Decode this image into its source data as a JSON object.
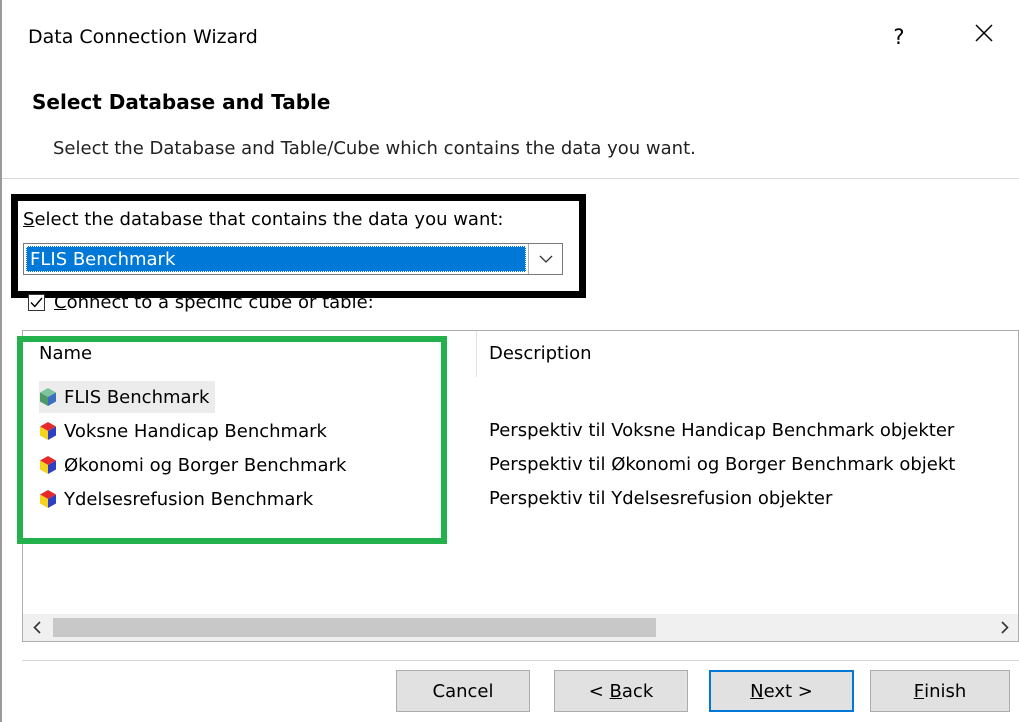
{
  "window": {
    "title": "Data Connection Wizard",
    "help_label": "?"
  },
  "page": {
    "heading": "Select Database and Table",
    "subheading": "Select the Database and Table/Cube which contains the data you want."
  },
  "database": {
    "label_mnemonic": "S",
    "label_rest": "elect the database that contains the data you want:",
    "selected": "FLIS Benchmark"
  },
  "connect_checkbox": {
    "checked": true,
    "label_mnemonic": "C",
    "label_rest": "onnect to a specific cube or table:"
  },
  "table": {
    "columns": {
      "name": "Name",
      "description": "Description"
    },
    "rows": [
      {
        "name": "FLIS Benchmark",
        "description": "",
        "icon": "cube-icon",
        "selected": true
      },
      {
        "name": "Voksne Handicap Benchmark",
        "description": "Perspektiv til Voksne Handicap Benchmark objekter",
        "icon": "perspective-icon",
        "selected": false
      },
      {
        "name": "Økonomi og Borger Benchmark",
        "description": "Perspektiv til Økonomi og Borger Benchmark objekt",
        "icon": "perspective-icon",
        "selected": false
      },
      {
        "name": "Ydelsesrefusion Benchmark",
        "description": "Perspektiv til Ydelsesrefusion objekter",
        "icon": "perspective-icon",
        "selected": false
      }
    ]
  },
  "buttons": {
    "cancel": "Cancel",
    "back_prefix": "< ",
    "back_mnemonic": "B",
    "back_rest": "ack",
    "next_mnemonic": "N",
    "next_rest": "ext >",
    "finish_mnemonic": "F",
    "finish_rest": "inish"
  },
  "colors": {
    "selection": "#0078d7",
    "highlight_green": "#22b14c",
    "highlight_black": "#000000"
  }
}
